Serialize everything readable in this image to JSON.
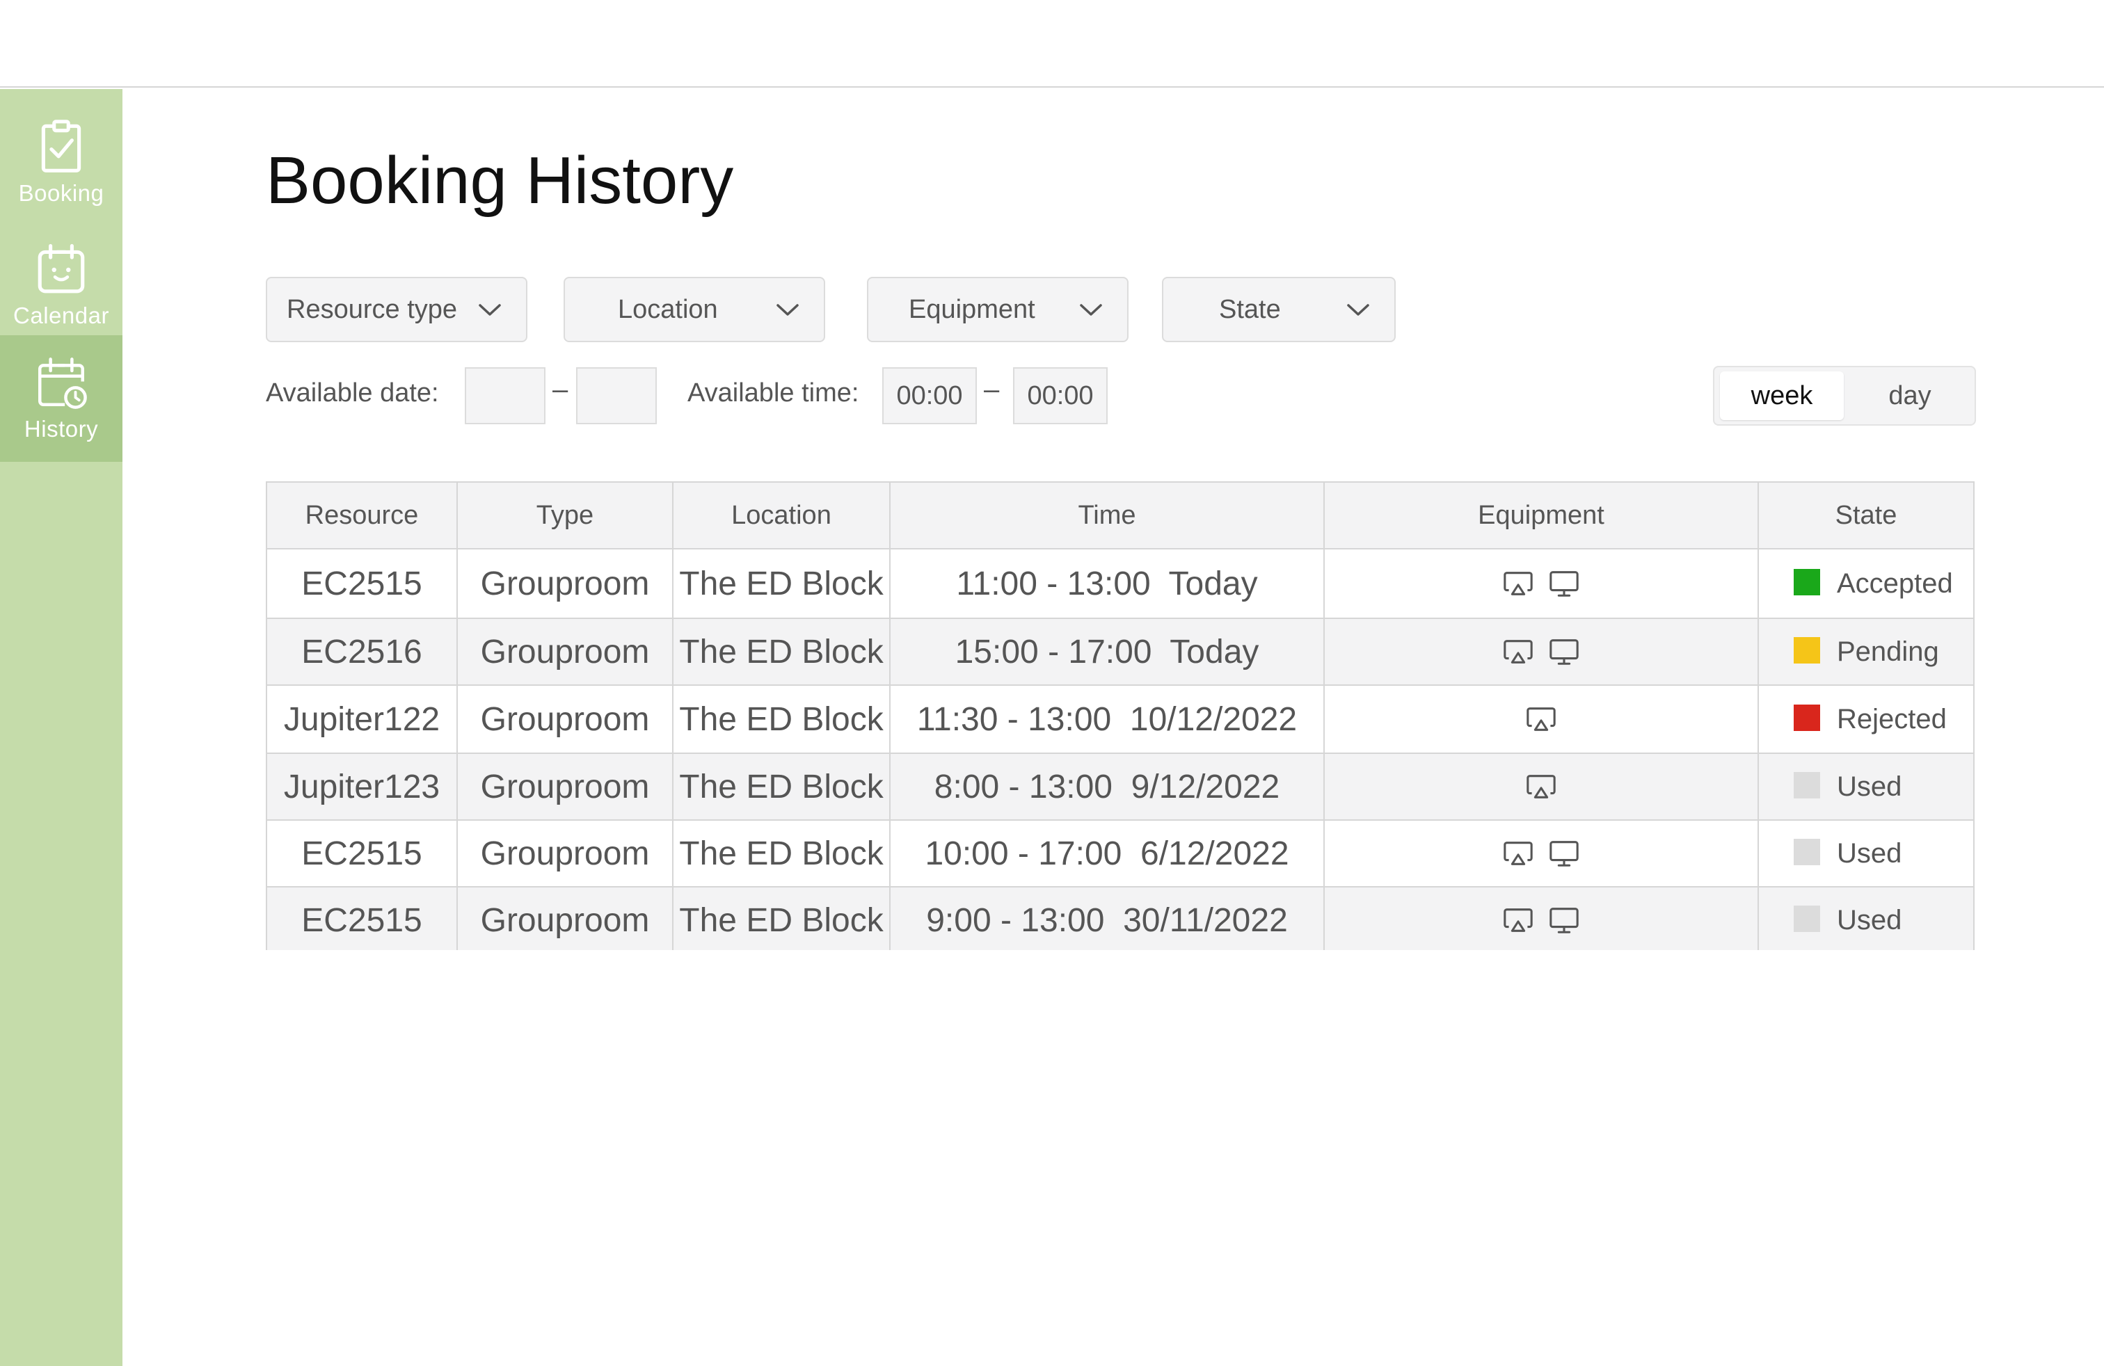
{
  "sidebar": {
    "items": [
      {
        "label": "Booking",
        "icon": "clipboard-check-icon"
      },
      {
        "label": "Calendar",
        "icon": "calendar-icon"
      },
      {
        "label": "History",
        "icon": "calendar-clock-icon",
        "active": true
      }
    ],
    "background_color": "#c5dcaa",
    "active_color": "#a9c98b"
  },
  "page": {
    "title": "Booking History"
  },
  "filters": {
    "resource_type": "Resource type",
    "location": "Location",
    "equipment": "Equipment",
    "state": "State",
    "available_date_label": "Available date:",
    "date_from": "",
    "date_to": "",
    "date_separator": "–",
    "available_time_label": "Available time:",
    "time_from": "00:00",
    "time_to": "00:00",
    "time_separator": "–"
  },
  "view_toggle": {
    "options": [
      "week",
      "day"
    ],
    "selected": "week"
  },
  "table": {
    "headers": [
      "Resource",
      "Type",
      "Location",
      "Time",
      "Equipment",
      "State"
    ],
    "rows": [
      {
        "resource": "EC2515",
        "type": "Grouproom",
        "location": "The ED Block",
        "time": "11:00 - 13:00  Today",
        "equipment": [
          "cast-icon",
          "monitor-icon"
        ],
        "state": "Accepted",
        "state_color": "#1aa81a"
      },
      {
        "resource": "EC2516",
        "type": "Grouproom",
        "location": "The ED Block",
        "time": "15:00 - 17:00  Today",
        "equipment": [
          "cast-icon",
          "monitor-icon"
        ],
        "state": "Pending",
        "state_color": "#f5c518"
      },
      {
        "resource": "Jupiter122",
        "type": "Grouproom",
        "location": "The ED Block",
        "time": "11:30 - 13:00  10/12/2022",
        "equipment": [
          "cast-icon"
        ],
        "state": "Rejected",
        "state_color": "#d9261c"
      },
      {
        "resource": "Jupiter123",
        "type": "Grouproom",
        "location": "The ED Block",
        "time": "8:00 - 13:00  9/12/2022",
        "equipment": [
          "cast-icon"
        ],
        "state": "Used",
        "state_color": "#dcdcdc"
      },
      {
        "resource": "EC2515",
        "type": "Grouproom",
        "location": "The ED Block",
        "time": "10:00 - 17:00  6/12/2022",
        "equipment": [
          "cast-icon",
          "monitor-icon"
        ],
        "state": "Used",
        "state_color": "#dcdcdc"
      },
      {
        "resource": "EC2515",
        "type": "Grouproom",
        "location": "The ED Block",
        "time": "9:00 - 13:00  30/11/2022",
        "equipment": [
          "cast-icon",
          "monitor-icon"
        ],
        "state": "Used",
        "state_color": "#dcdcdc"
      }
    ]
  }
}
